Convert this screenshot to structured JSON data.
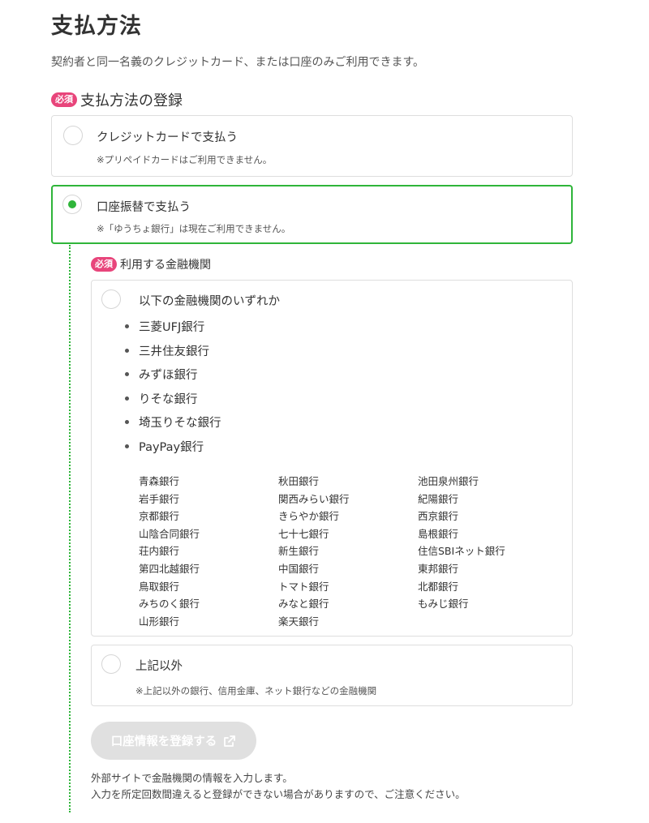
{
  "page": {
    "title": "支払方法",
    "description": "契約者と同一名義のクレジットカード、または口座のみご利用できます。"
  },
  "payment_section": {
    "required_badge": "必須",
    "heading": "支払方法の登録",
    "options": [
      {
        "label": "クレジットカードで支払う",
        "note": "※プリペイドカードはご利用できません。",
        "selected": false
      },
      {
        "label": "口座振替で支払う",
        "note": "※「ゆうちょ銀行」は現在ご利用できません。",
        "selected": true
      }
    ]
  },
  "bank_section": {
    "required_badge": "必須",
    "heading": "利用する金融機関",
    "option_listed": {
      "label": "以下の金融機関のいずれか",
      "selected": false,
      "major_banks": [
        "三菱UFJ銀行",
        "三井住友銀行",
        "みずほ銀行",
        "りそな銀行",
        "埼玉りそな銀行",
        "PayPay銀行"
      ],
      "regional_banks": [
        [
          "青森銀行",
          "岩手銀行",
          "京都銀行",
          "山陰合同銀行",
          "荘内銀行",
          "第四北越銀行",
          "鳥取銀行",
          "みちのく銀行",
          "山形銀行"
        ],
        [
          "秋田銀行",
          "関西みらい銀行",
          "きらやか銀行",
          "七十七銀行",
          "新生銀行",
          "中国銀行",
          "トマト銀行",
          "みなと銀行",
          "楽天銀行"
        ],
        [
          "池田泉州銀行",
          "紀陽銀行",
          "西京銀行",
          "島根銀行",
          "住信SBIネット銀行",
          "東邦銀行",
          "北都銀行",
          "もみじ銀行"
        ]
      ]
    },
    "option_other": {
      "label": "上記以外",
      "note": "※上記以外の銀行、信用金庫、ネット銀行などの金融機関",
      "selected": false
    },
    "register_button": {
      "label": "口座情報を登録する",
      "icon": "external-link-icon",
      "disabled": true
    },
    "footnotes": [
      "外部サイトで金融機関の情報を入力します。",
      "入力を所定回数間違えると登録ができない場合がありますので、ご注意ください。"
    ]
  },
  "colors": {
    "accent_green": "#2fb53a",
    "required_pink": "#e8457b",
    "button_disabled": "#e0e0e0"
  }
}
